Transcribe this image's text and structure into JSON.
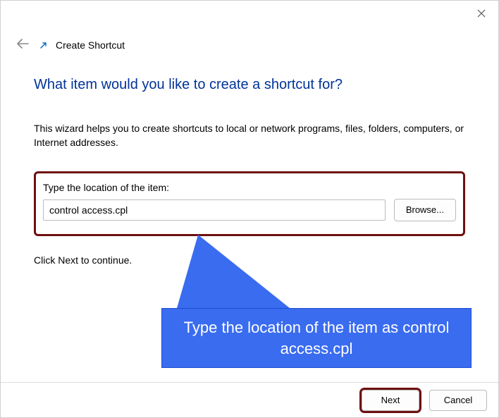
{
  "window": {
    "title": "Create Shortcut"
  },
  "page": {
    "heading": "What item would you like to create a shortcut for?",
    "description": "This wizard helps you to create shortcuts to local or network programs, files, folders, computers, or Internet addresses.",
    "field_label": "Type the location of the item:",
    "location_value": "control access.cpl",
    "browse_label": "Browse...",
    "continue_text": "Click Next to continue."
  },
  "callout": {
    "text": "Type the location of the item as control access.cpl"
  },
  "footer": {
    "next_label": "Next",
    "cancel_label": "Cancel"
  },
  "annotation_colors": {
    "highlight_border": "#6d1010",
    "callout_bg": "#3a6cf0"
  }
}
